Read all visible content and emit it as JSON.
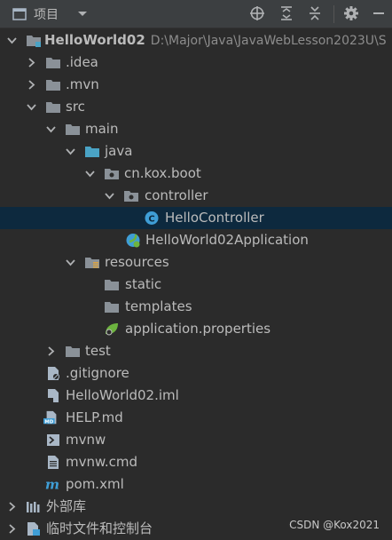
{
  "header": {
    "title": "项目",
    "icons": [
      "project-view-icon",
      "chevron-down-icon",
      "locate-icon",
      "expand-all-icon",
      "collapse-all-icon",
      "settings-icon",
      "hide-icon"
    ]
  },
  "tree": {
    "root": {
      "name": "HelloWorld02",
      "path": "D:\\Major\\Java\\JavaWebLesson2023U\\S"
    },
    "items": [
      {
        "label": ".idea"
      },
      {
        "label": ".mvn"
      },
      {
        "label": "src"
      },
      {
        "label": "main"
      },
      {
        "label": "java"
      },
      {
        "label": "cn.kox.boot"
      },
      {
        "label": "controller"
      },
      {
        "label": "HelloController"
      },
      {
        "label": "HelloWorld02Application"
      },
      {
        "label": "resources"
      },
      {
        "label": "static"
      },
      {
        "label": "templates"
      },
      {
        "label": "application.properties"
      },
      {
        "label": "test"
      },
      {
        "label": ".gitignore"
      },
      {
        "label": "HelloWorld02.iml"
      },
      {
        "label": "HELP.md"
      },
      {
        "label": "mvnw"
      },
      {
        "label": "mvnw.cmd"
      },
      {
        "label": "pom.xml"
      },
      {
        "label": "外部库"
      },
      {
        "label": "临时文件和控制台"
      }
    ]
  },
  "watermark": "CSDN @Kox2021",
  "colors": {
    "background": "#2b2b2b",
    "header": "#3c3f41",
    "selection": "#0d293e",
    "text": "#bbbbbb",
    "folder": "#8a9198",
    "source_folder": "#4aa3c5",
    "class_icon": "#3f9ed6",
    "spring": "#6db33f"
  }
}
